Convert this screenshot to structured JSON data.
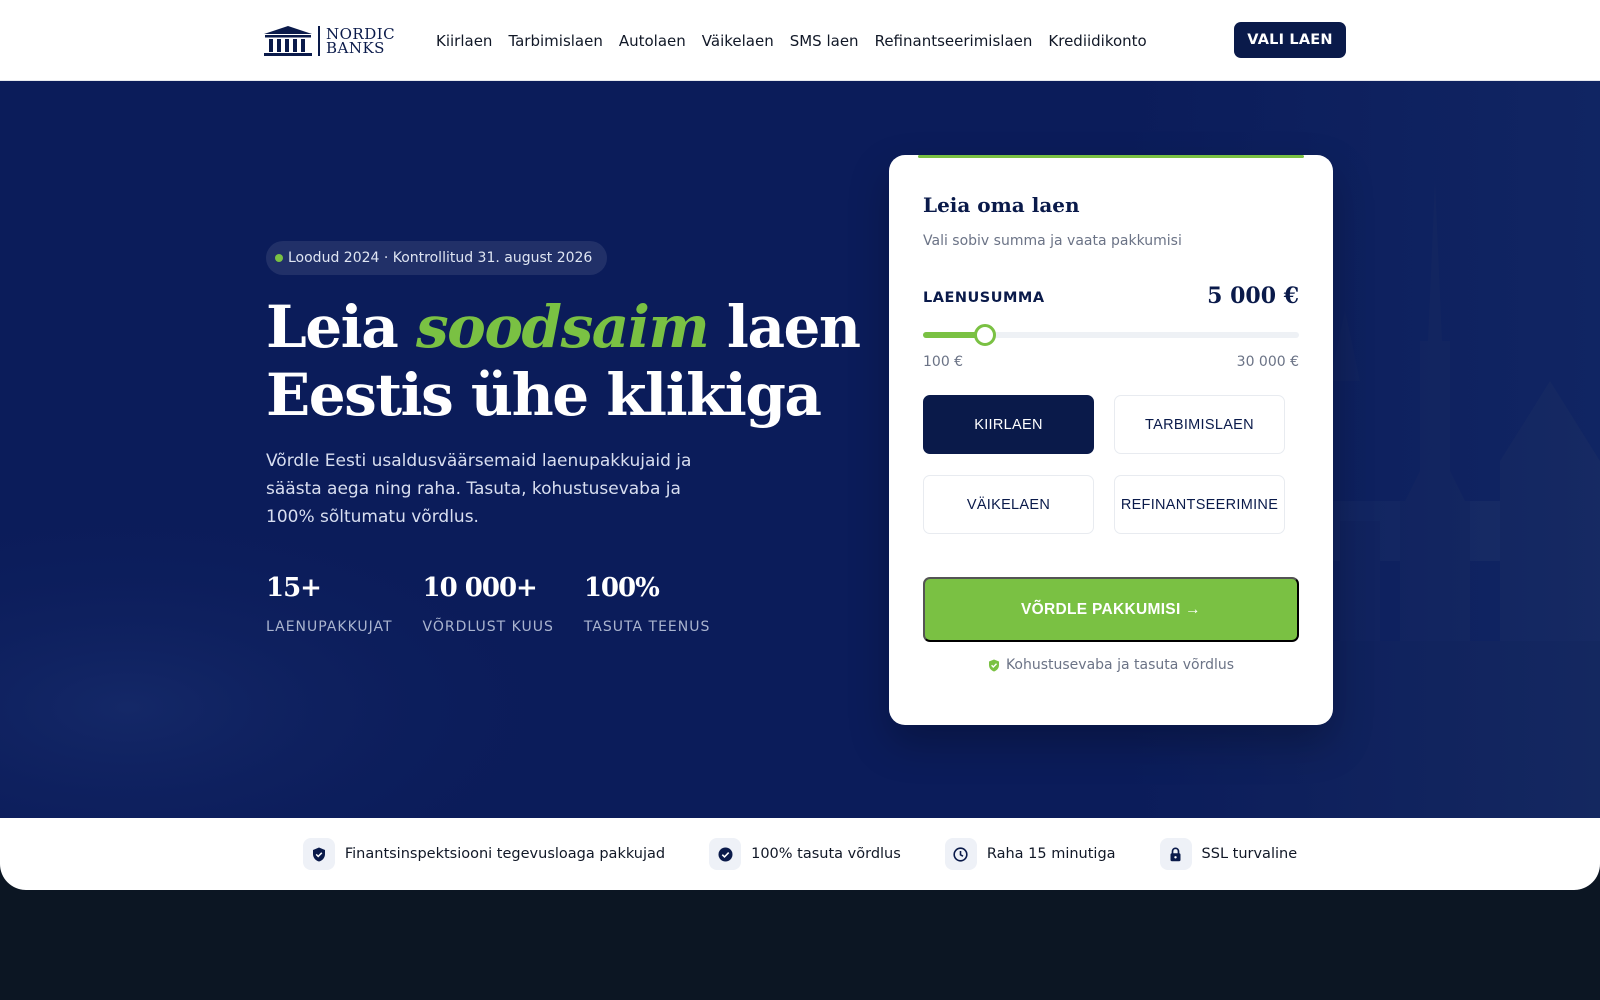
{
  "brand": {
    "line1": "NORDIC",
    "line2": "BANKS",
    "navy": "#0a1a4a",
    "green": "#7ac143"
  },
  "nav": {
    "items": [
      "Kiirlaen",
      "Tarbimislaen",
      "Autolaen",
      "Väikelaen",
      "SMS laen",
      "Refinantseerimislaen",
      "Krediidikonto"
    ],
    "cta": "VALI LAEN"
  },
  "hero": {
    "badge": "Loodud 2024 · Kontrollitud  31. august 2026",
    "headline_pre": "Leia ",
    "headline_accent": "soodsaim",
    "headline_post": " laen",
    "headline_line2": "Eestis ühe klikiga",
    "lead": "Võrdle Eesti usaldusväärsemaid laenupakkujaid ja säästa aega ning raha. Tasuta, kohustusevaba ja 100% sõltumatu võrdlus.",
    "stats": [
      {
        "value": "15+",
        "label": "LAENUPAKKUJAT"
      },
      {
        "value": "10 000+",
        "label": "VÕRDLUST KUUS"
      },
      {
        "value": "100%",
        "label": "TASUTA TEENUS"
      }
    ]
  },
  "card": {
    "title": "Leia oma laen",
    "subtitle": "Vali sobiv summa ja vaata pakkumisi",
    "amount_label": "LAENUSUMMA",
    "amount_value": "5 000 €",
    "slider": {
      "min": 100,
      "max": 30000,
      "value": 5000
    },
    "min_label": "100 €",
    "max_label": "30 000 €",
    "types": [
      "KIIRLAEN",
      "TARBIMISLAEN",
      "VÄIKELAEN",
      "REFINANTSEERIMINE"
    ],
    "selected_type": "KIIRLAEN",
    "compare_label": "VÕRDLE PAKKUMISI →",
    "note": "Kohustusevaba ja tasuta võrdlus"
  },
  "trust": [
    {
      "icon": "shield-check-icon",
      "label": "Finantsinspektsiooni tegevusloaga pakkujad"
    },
    {
      "icon": "check-circle-icon",
      "label": "100% tasuta võrdlus"
    },
    {
      "icon": "clock-icon",
      "label": "Raha 15 minutiga"
    },
    {
      "icon": "lock-icon",
      "label": "SSL turvaline"
    }
  ]
}
